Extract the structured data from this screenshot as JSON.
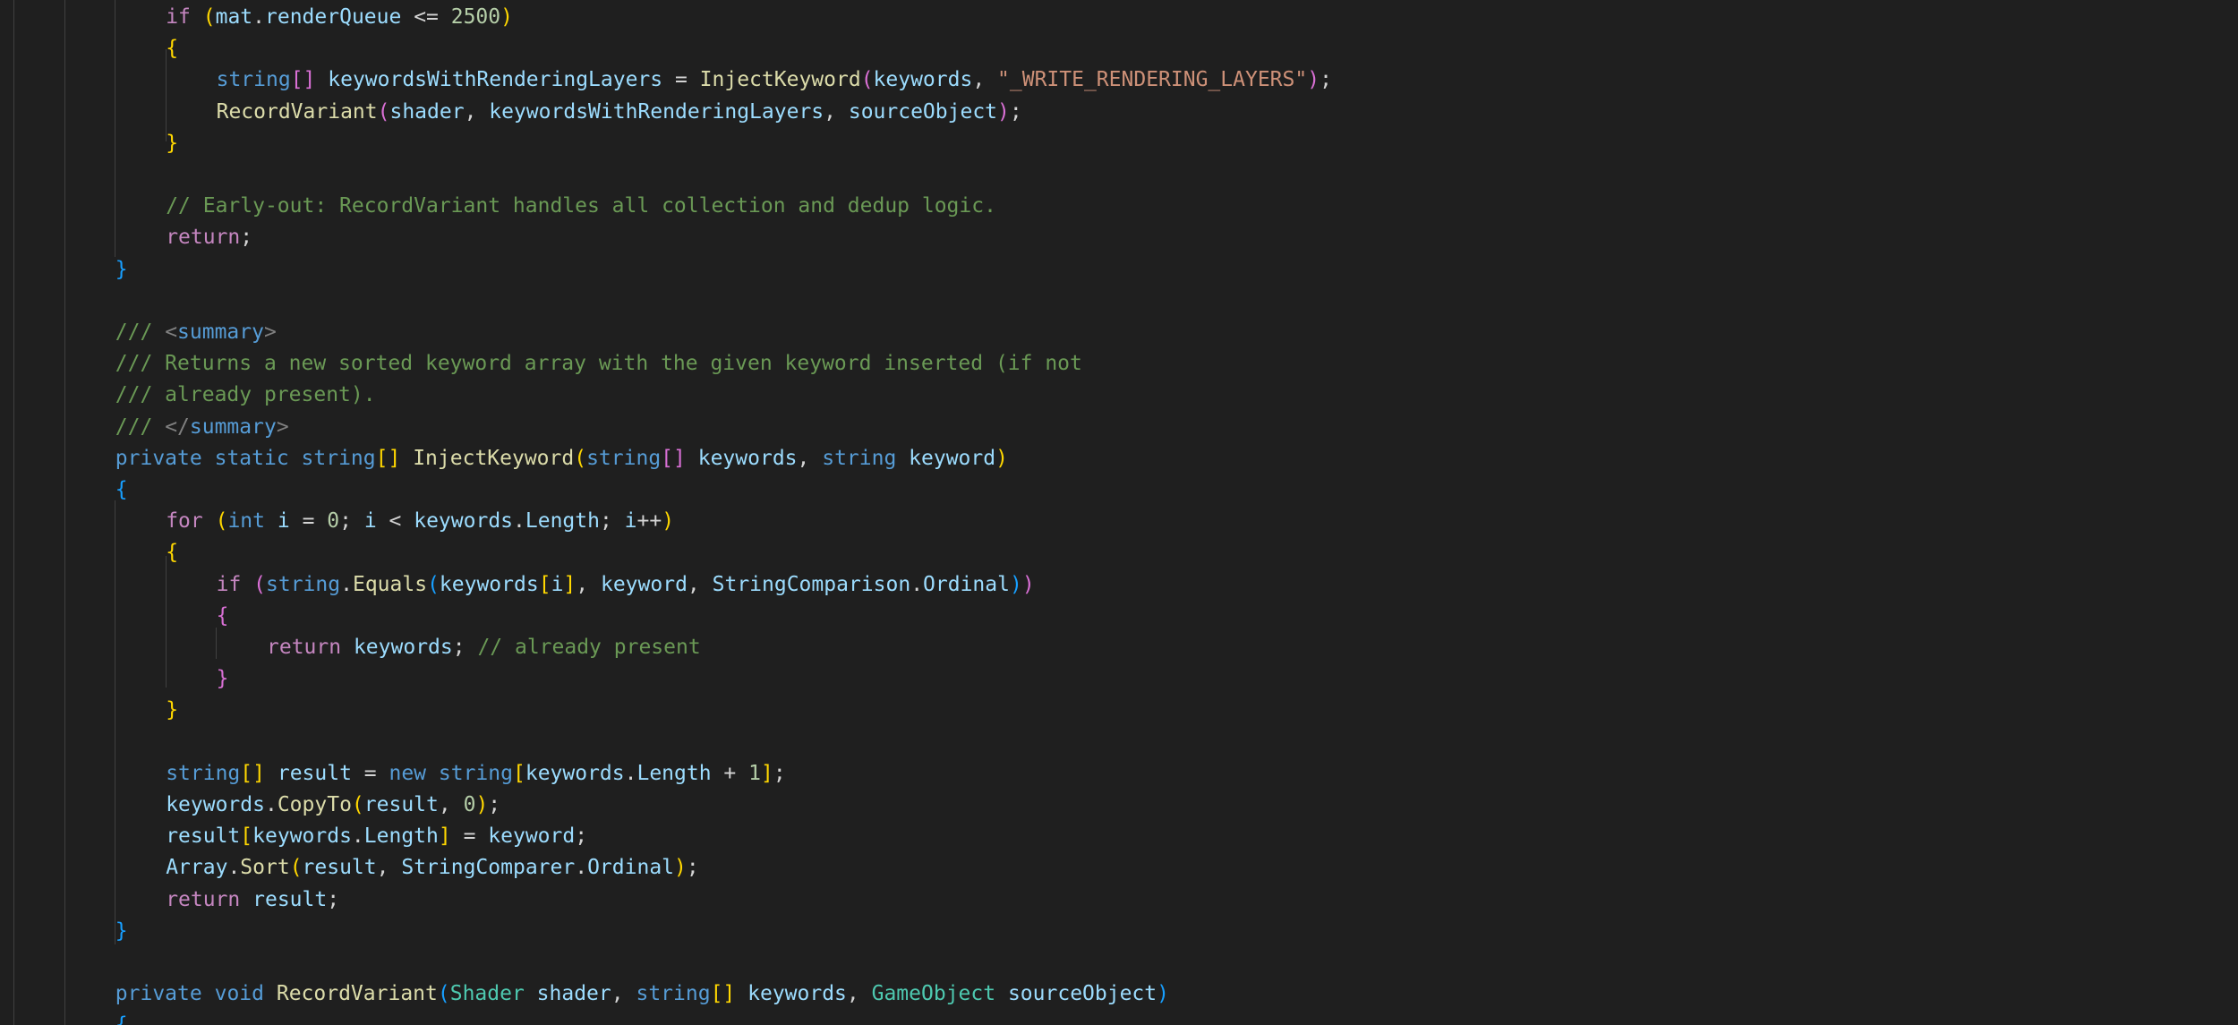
{
  "editor": {
    "language": "C#",
    "lines": [
      [
        [
          "ctl",
          "if"
        ],
        [
          "pun",
          " "
        ],
        [
          "b1",
          "("
        ],
        [
          "var",
          "mat"
        ],
        [
          "pun",
          "."
        ],
        [
          "var",
          "renderQueue"
        ],
        [
          "pun",
          " <= "
        ],
        [
          "num",
          "2500"
        ],
        [
          "b1",
          ")"
        ]
      ],
      [
        [
          "b1",
          "{"
        ]
      ],
      [
        [
          "kw",
          "string"
        ],
        [
          "b2",
          "[]"
        ],
        [
          "pun",
          " "
        ],
        [
          "var",
          "keywordsWithRenderingLayers"
        ],
        [
          "pun",
          " = "
        ],
        [
          "fn",
          "InjectKeyword"
        ],
        [
          "b2",
          "("
        ],
        [
          "var",
          "keywords"
        ],
        [
          "pun",
          ", "
        ],
        [
          "str",
          "\"_WRITE_RENDERING_LAYERS\""
        ],
        [
          "b2",
          ")"
        ],
        [
          "pun",
          ";"
        ]
      ],
      [
        [
          "fn",
          "RecordVariant"
        ],
        [
          "b2",
          "("
        ],
        [
          "var",
          "shader"
        ],
        [
          "pun",
          ", "
        ],
        [
          "var",
          "keywordsWithRenderingLayers"
        ],
        [
          "pun",
          ", "
        ],
        [
          "var",
          "sourceObject"
        ],
        [
          "b2",
          ")"
        ],
        [
          "pun",
          ";"
        ]
      ],
      [
        [
          "b1",
          "}"
        ]
      ],
      [],
      [
        [
          "com",
          "// Early-out: RecordVariant handles all collection and dedup logic."
        ]
      ],
      [
        [
          "ctl",
          "return"
        ],
        [
          "pun",
          ";"
        ]
      ],
      [
        [
          "b3",
          "}"
        ]
      ],
      [],
      [
        [
          "com",
          "/// "
        ],
        [
          "tag",
          "<"
        ],
        [
          "kw",
          "summary"
        ],
        [
          "tag",
          ">"
        ]
      ],
      [
        [
          "com",
          "/// Returns a new sorted keyword array with the given keyword inserted (if not"
        ]
      ],
      [
        [
          "com",
          "/// already present)."
        ]
      ],
      [
        [
          "com",
          "/// "
        ],
        [
          "tag",
          "</"
        ],
        [
          "kw",
          "summary"
        ],
        [
          "tag",
          ">"
        ]
      ],
      [
        [
          "kw",
          "private"
        ],
        [
          "pun",
          " "
        ],
        [
          "kw",
          "static"
        ],
        [
          "pun",
          " "
        ],
        [
          "kw",
          "string"
        ],
        [
          "b1",
          "[]"
        ],
        [
          "pun",
          " "
        ],
        [
          "fn",
          "InjectKeyword"
        ],
        [
          "b1",
          "("
        ],
        [
          "kw",
          "string"
        ],
        [
          "b2",
          "[]"
        ],
        [
          "pun",
          " "
        ],
        [
          "var",
          "keywords"
        ],
        [
          "pun",
          ", "
        ],
        [
          "kw",
          "string"
        ],
        [
          "pun",
          " "
        ],
        [
          "var",
          "keyword"
        ],
        [
          "b1",
          ")"
        ]
      ],
      [
        [
          "b3",
          "{"
        ]
      ],
      [
        [
          "ctl",
          "for"
        ],
        [
          "pun",
          " "
        ],
        [
          "b1",
          "("
        ],
        [
          "kw",
          "int"
        ],
        [
          "pun",
          " "
        ],
        [
          "var",
          "i"
        ],
        [
          "pun",
          " = "
        ],
        [
          "num",
          "0"
        ],
        [
          "pun",
          "; "
        ],
        [
          "var",
          "i"
        ],
        [
          "pun",
          " < "
        ],
        [
          "var",
          "keywords"
        ],
        [
          "pun",
          "."
        ],
        [
          "var",
          "Length"
        ],
        [
          "pun",
          "; "
        ],
        [
          "var",
          "i"
        ],
        [
          "pun",
          "++"
        ],
        [
          "b1",
          ")"
        ]
      ],
      [
        [
          "b1",
          "{"
        ]
      ],
      [
        [
          "ctl",
          "if"
        ],
        [
          "pun",
          " "
        ],
        [
          "b2",
          "("
        ],
        [
          "kw",
          "string"
        ],
        [
          "pun",
          "."
        ],
        [
          "fn",
          "Equals"
        ],
        [
          "b3",
          "("
        ],
        [
          "var",
          "keywords"
        ],
        [
          "b1",
          "["
        ],
        [
          "var",
          "i"
        ],
        [
          "b1",
          "]"
        ],
        [
          "pun",
          ", "
        ],
        [
          "var",
          "keyword"
        ],
        [
          "pun",
          ", "
        ],
        [
          "var",
          "StringComparison"
        ],
        [
          "pun",
          "."
        ],
        [
          "var",
          "Ordinal"
        ],
        [
          "b3",
          ")"
        ],
        [
          "b2",
          ")"
        ]
      ],
      [
        [
          "b2",
          "{"
        ]
      ],
      [
        [
          "ctl",
          "return"
        ],
        [
          "pun",
          " "
        ],
        [
          "var",
          "keywords"
        ],
        [
          "pun",
          "; "
        ],
        [
          "com",
          "// already present"
        ]
      ],
      [
        [
          "b2",
          "}"
        ]
      ],
      [
        [
          "b1",
          "}"
        ]
      ],
      [],
      [
        [
          "kw",
          "string"
        ],
        [
          "b1",
          "[]"
        ],
        [
          "pun",
          " "
        ],
        [
          "var",
          "result"
        ],
        [
          "pun",
          " = "
        ],
        [
          "kw",
          "new"
        ],
        [
          "pun",
          " "
        ],
        [
          "kw",
          "string"
        ],
        [
          "b1",
          "["
        ],
        [
          "var",
          "keywords"
        ],
        [
          "pun",
          "."
        ],
        [
          "var",
          "Length"
        ],
        [
          "pun",
          " + "
        ],
        [
          "num",
          "1"
        ],
        [
          "b1",
          "]"
        ],
        [
          "pun",
          ";"
        ]
      ],
      [
        [
          "var",
          "keywords"
        ],
        [
          "pun",
          "."
        ],
        [
          "fn",
          "CopyTo"
        ],
        [
          "b1",
          "("
        ],
        [
          "var",
          "result"
        ],
        [
          "pun",
          ", "
        ],
        [
          "num",
          "0"
        ],
        [
          "b1",
          ")"
        ],
        [
          "pun",
          ";"
        ]
      ],
      [
        [
          "var",
          "result"
        ],
        [
          "b1",
          "["
        ],
        [
          "var",
          "keywords"
        ],
        [
          "pun",
          "."
        ],
        [
          "var",
          "Length"
        ],
        [
          "b1",
          "]"
        ],
        [
          "pun",
          " = "
        ],
        [
          "var",
          "keyword"
        ],
        [
          "pun",
          ";"
        ]
      ],
      [
        [
          "var",
          "Array"
        ],
        [
          "pun",
          "."
        ],
        [
          "fn",
          "Sort"
        ],
        [
          "b1",
          "("
        ],
        [
          "var",
          "result"
        ],
        [
          "pun",
          ", "
        ],
        [
          "var",
          "StringComparer"
        ],
        [
          "pun",
          "."
        ],
        [
          "var",
          "Ordinal"
        ],
        [
          "b1",
          ")"
        ],
        [
          "pun",
          ";"
        ]
      ],
      [
        [
          "ctl",
          "return"
        ],
        [
          "pun",
          " "
        ],
        [
          "var",
          "result"
        ],
        [
          "pun",
          ";"
        ]
      ],
      [
        [
          "b3",
          "}"
        ]
      ],
      [],
      [
        [
          "kw",
          "private"
        ],
        [
          "pun",
          " "
        ],
        [
          "kw",
          "void"
        ],
        [
          "pun",
          " "
        ],
        [
          "fn",
          "RecordVariant"
        ],
        [
          "b3",
          "("
        ],
        [
          "typ",
          "Shader"
        ],
        [
          "pun",
          " "
        ],
        [
          "var",
          "shader"
        ],
        [
          "pun",
          ", "
        ],
        [
          "kw",
          "string"
        ],
        [
          "b1",
          "[]"
        ],
        [
          "pun",
          " "
        ],
        [
          "var",
          "keywords"
        ],
        [
          "pun",
          ", "
        ],
        [
          "typ",
          "GameObject"
        ],
        [
          "pun",
          " "
        ],
        [
          "var",
          "sourceObject"
        ],
        [
          "b3",
          ")"
        ]
      ],
      [
        [
          "b3",
          "{"
        ]
      ]
    ]
  }
}
